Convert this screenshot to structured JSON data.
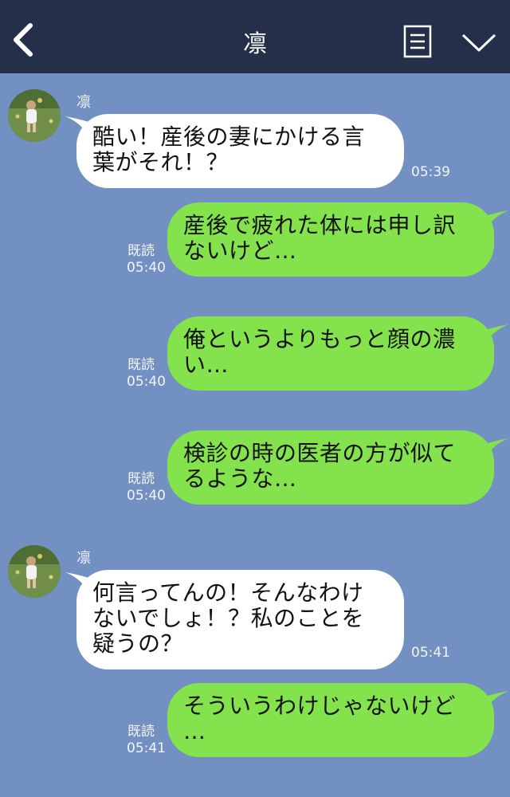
{
  "header": {
    "title": "凛"
  },
  "messages": [
    {
      "side": "left",
      "sender": "凛",
      "text": "酷い！産後の妻にかける言\n葉がそれ！？",
      "time": "05:39"
    },
    {
      "side": "right",
      "read": "既読",
      "text": "産後で疲れた体には申し訳\nないけど…",
      "time": "05:40"
    },
    {
      "side": "right",
      "read": "既読",
      "text": "俺というよりもっと顔の濃\nい…",
      "time": "05:40"
    },
    {
      "side": "right",
      "read": "既読",
      "text": "検診の時の医者の方が似て\nるような…",
      "time": "05:40"
    },
    {
      "side": "left",
      "sender": "凛",
      "text": "何言ってんの！そんなわけ\nないでしょ！？私のことを\n疑うの？",
      "time": "05:41"
    },
    {
      "side": "right",
      "read": "既読",
      "text": "そういうわけじゃないけど\n…",
      "time": "05:41"
    }
  ],
  "colors": {
    "background": "#7290c2",
    "header": "#243049",
    "bubble_left": "#ffffff",
    "bubble_right": "#84e34c"
  }
}
